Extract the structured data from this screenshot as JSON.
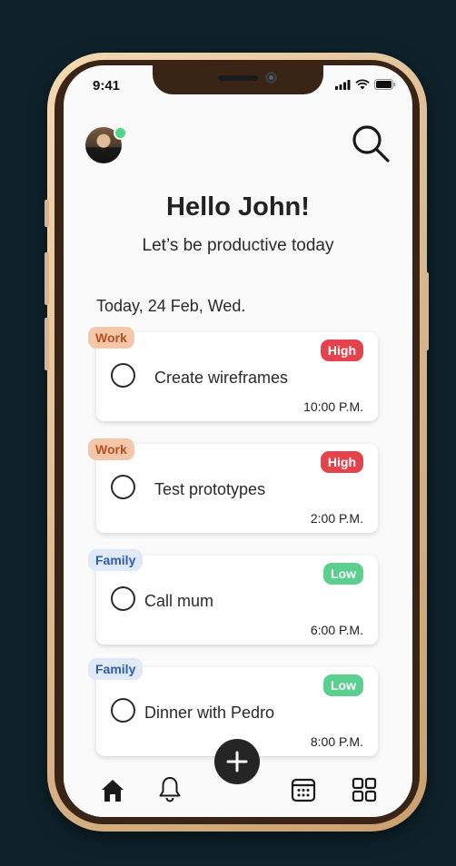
{
  "status_bar": {
    "time": "9:41"
  },
  "header": {
    "greeting": "Hello John!",
    "subtitle": "Let’s be productive today"
  },
  "date_label": "Today, 24 Feb, Wed.",
  "tasks": [
    {
      "category": "Work",
      "title": "Create wireframes",
      "priority": "High",
      "time": "10:00 P.M."
    },
    {
      "category": "Work",
      "title": "Test prototypes",
      "priority": "High",
      "time": "2:00 P.M."
    },
    {
      "category": "Family",
      "title": "Call mum",
      "priority": "Low",
      "time": "6:00 P.M."
    },
    {
      "category": "Family",
      "title": "Dinner with Pedro",
      "priority": "Low",
      "time": "8:00 P.M."
    }
  ],
  "icons": {
    "search": "search-icon",
    "home": "home-icon",
    "notifications": "bell-icon",
    "add": "plus-icon",
    "calendar": "calendar-icon",
    "apps": "grid-icon"
  },
  "colors": {
    "background": "#0f222b",
    "frame": "#d8b58a",
    "high_priority": "#e4434b",
    "low_priority": "#5bd08e",
    "work_tag_bg": "#f5c7a8",
    "work_tag_text": "#b54f22",
    "family_tag_bg": "#dfe9f8",
    "family_tag_text": "#2b5db0",
    "online": "#4cd68a"
  }
}
